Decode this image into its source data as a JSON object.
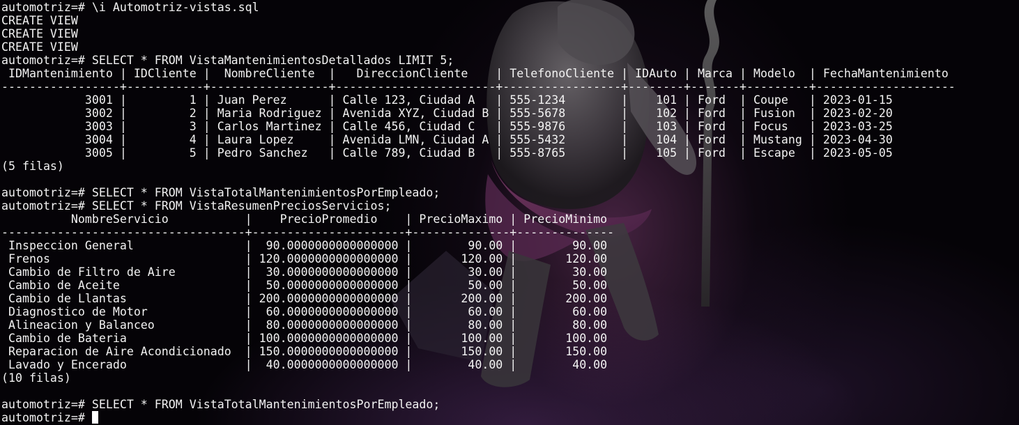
{
  "terminal": {
    "lines": [
      "automotriz=# \\i Automotriz-vistas.sql",
      "CREATE VIEW",
      "CREATE VIEW",
      "CREATE VIEW",
      "automotriz=# SELECT * FROM VistaMantenimientosDetallados LIMIT 5;",
      " IDMantenimiento | IDCliente |  NombreCliente  |   DireccionCliente    | TelefonoCliente | IDAuto | Marca | Modelo  | FechaMantenimiento",
      "-----------------+-----------+-----------------+-----------------------+-----------------+--------+-------+---------+--------------------",
      "            3001 |         1 | Juan Perez      | Calle 123, Ciudad A   | 555-1234        |    101 | Ford  | Coupe   | 2023-01-15",
      "            3002 |         2 | Maria Rodriguez | Avenida XYZ, Ciudad B | 555-5678        |    102 | Ford  | Fusion  | 2023-02-20",
      "            3003 |         3 | Carlos Martinez | Calle 456, Ciudad C   | 555-9876        |    103 | Ford  | Focus   | 2023-03-25",
      "            3004 |         4 | Laura Lopez     | Avenida LMN, Ciudad A | 555-5432        |    104 | Ford  | Mustang | 2023-04-30",
      "            3005 |         5 | Pedro Sanchez   | Calle 789, Ciudad B   | 555-8765        |    105 | Ford  | Escape  | 2023-05-05",
      "(5 filas)",
      "",
      "automotriz=# SELECT * FROM VistaTotalMantenimientosPorEmpleado;",
      "automotriz=# SELECT * FROM VistaResumenPreciosServicios;",
      "          NombreServicio           |    PrecioPromedio    | PrecioMaximo | PrecioMinimo",
      "-----------------------------------+----------------------+--------------+--------------",
      " Inspeccion General                |  90.0000000000000000 |        90.00 |        90.00",
      " Frenos                            | 120.0000000000000000 |       120.00 |       120.00",
      " Cambio de Filtro de Aire          |  30.0000000000000000 |        30.00 |        30.00",
      " Cambio de Aceite                  |  50.0000000000000000 |        50.00 |        50.00",
      " Cambio de Llantas                 | 200.0000000000000000 |       200.00 |       200.00",
      " Diagnostico de Motor              |  60.0000000000000000 |        60.00 |        60.00",
      " Alineacion y Balanceo             |  80.0000000000000000 |        80.00 |        80.00",
      " Cambio de Bateria                 | 100.0000000000000000 |       100.00 |       100.00",
      " Reparacion de Aire Acondicionado  | 150.0000000000000000 |       150.00 |       150.00",
      " Lavado y Encerado                 |  40.0000000000000000 |        40.00 |        40.00",
      "(10 filas)",
      "",
      "automotriz=# SELECT * FROM VistaTotalMantenimientosPorEmpleado;"
    ],
    "prompt": "automotriz=# "
  },
  "colors": {
    "foreground": "#f2f2f2",
    "background": "#050307",
    "cursor": "#ffffff"
  }
}
